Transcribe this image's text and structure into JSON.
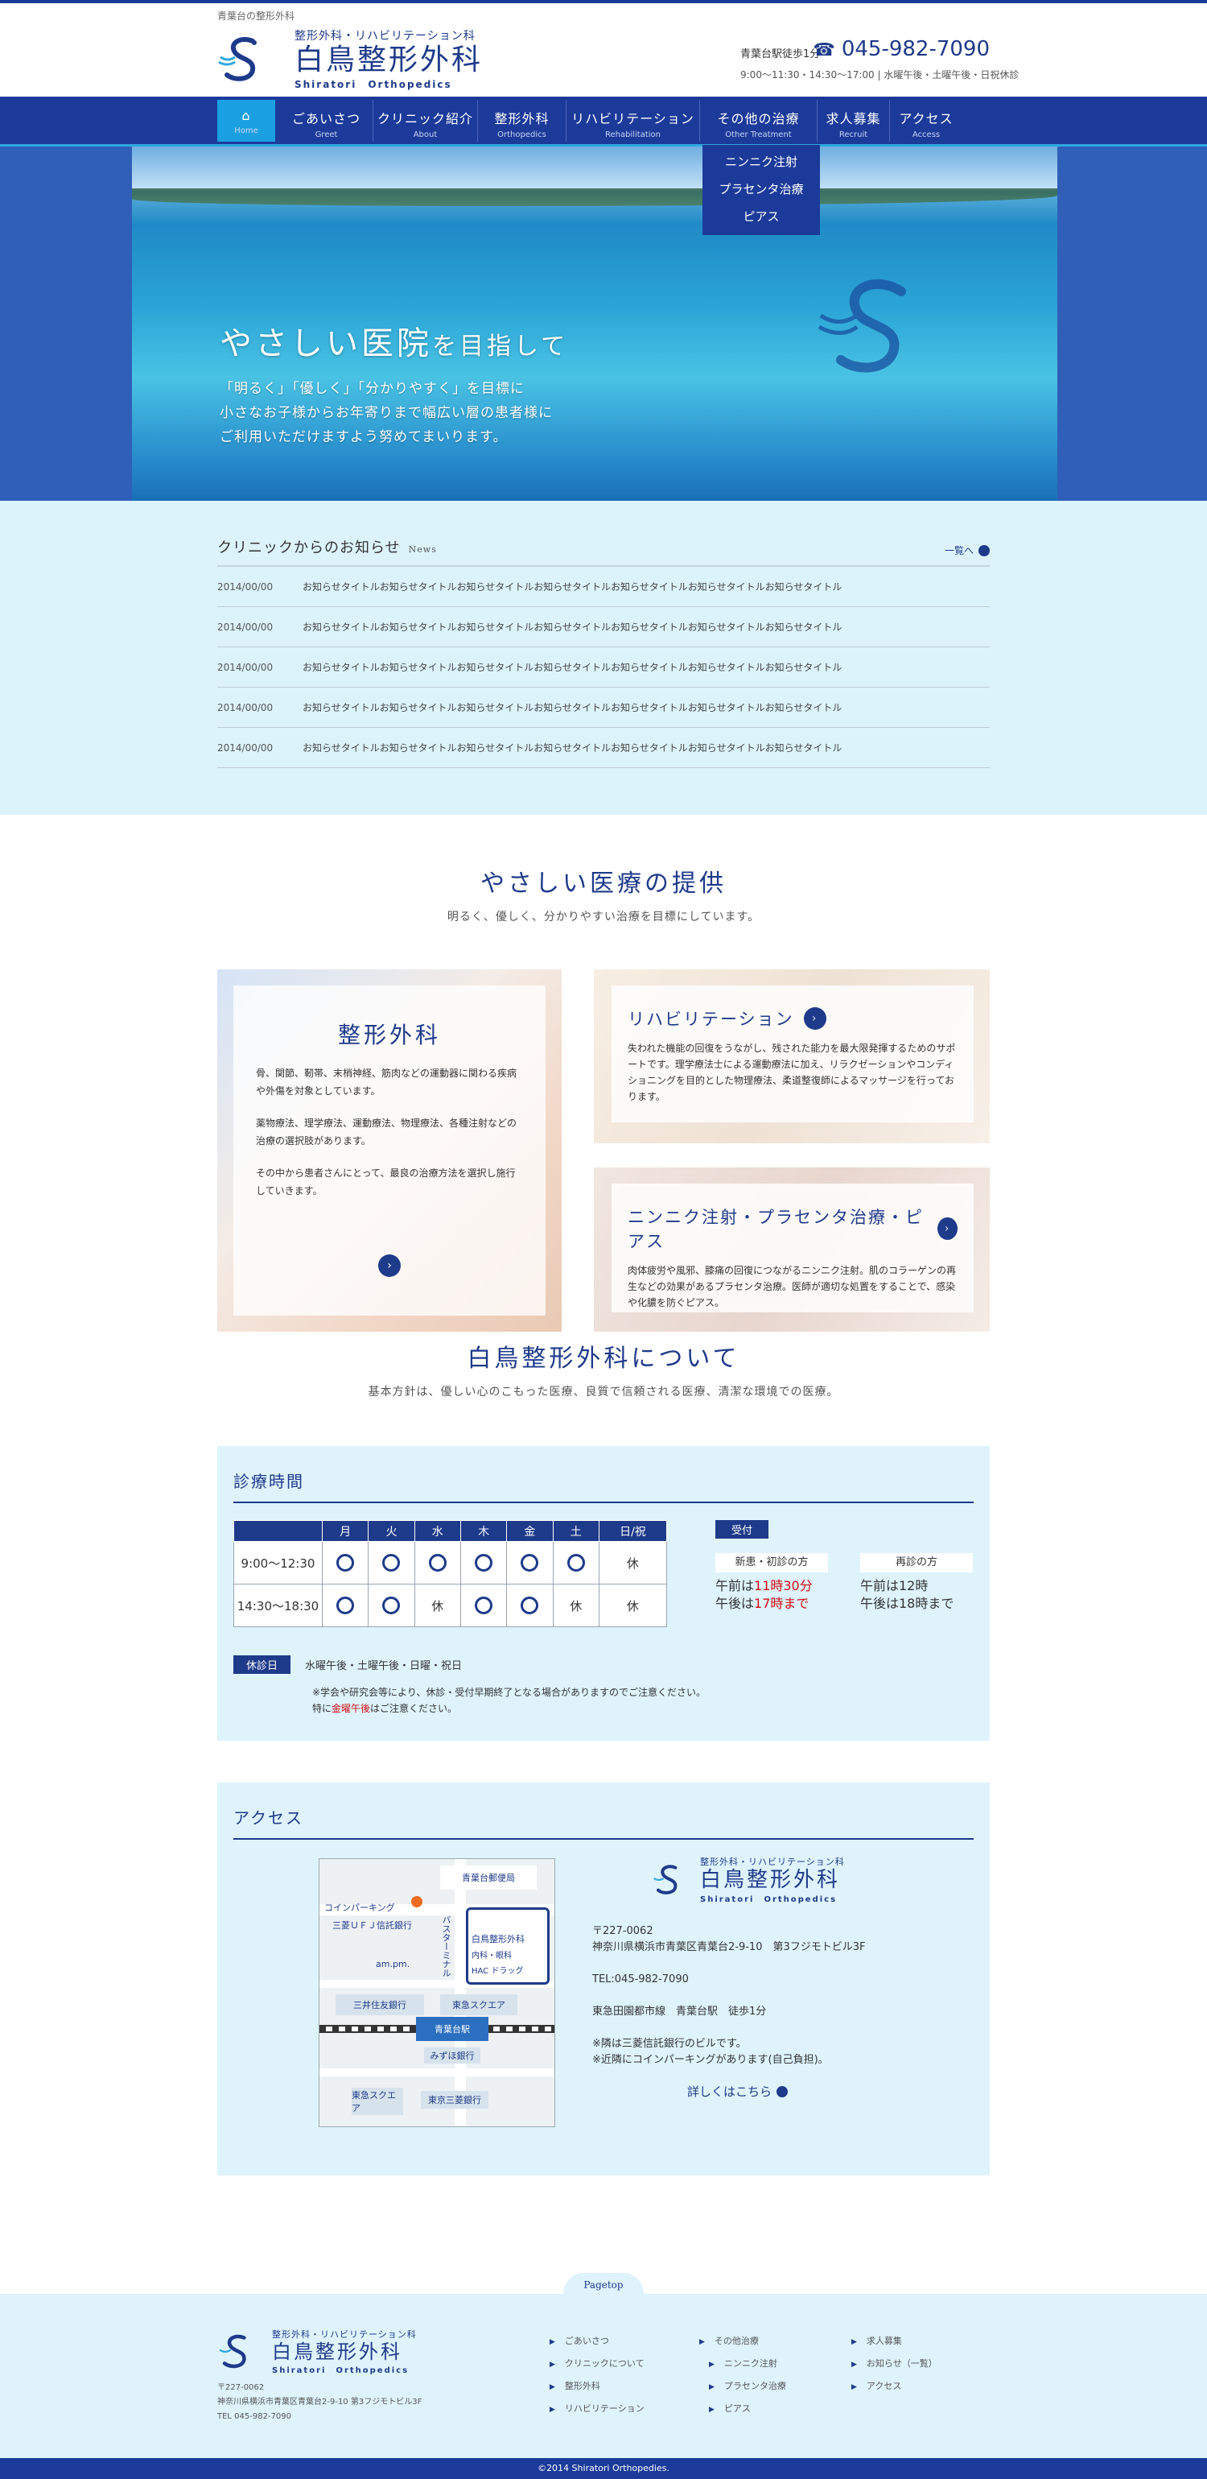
{
  "header": {
    "tagline": "青葉台の整形外科",
    "logo_sub": "整形外科・リハビリテーション科",
    "logo_main": "白鳥整形外科",
    "logo_en": "Shiratori　Orthopedics",
    "station": "青葉台駅徒歩1分",
    "phone": "045-982-7090",
    "hours": "9:00～11:30・14:30～17:00 | 水曜午後・土曜午後・日祝休診"
  },
  "nav": [
    {
      "jp": "",
      "en": "Home"
    },
    {
      "jp": "ごあいさつ",
      "en": "Greet"
    },
    {
      "jp": "クリニック紹介",
      "en": "About"
    },
    {
      "jp": "整形外科",
      "en": "Orthopedics"
    },
    {
      "jp": "リハビリテーション",
      "en": "Rehabilitation"
    },
    {
      "jp": "その他の治療",
      "en": "Other Treatment"
    },
    {
      "jp": "求人募集",
      "en": "Recruit"
    },
    {
      "jp": "アクセス",
      "en": "Access"
    }
  ],
  "dropdown": [
    "ニンニク注射",
    "プラセンタ治療",
    "ピアス"
  ],
  "hero": {
    "title_a": "やさしい医院",
    "title_b": "を目指して",
    "line1": "「明るく」「優しく」「分かりやすく」を目標に",
    "line2": "小さなお子様からお年寄りまで幅広い層の患者様に",
    "line3": "ご利用いただけますよう努めてまいります。"
  },
  "news": {
    "title": "クリニックからのお知らせ",
    "title_en": "News",
    "more": "一覧へ",
    "items": [
      {
        "date": "2014/00/00",
        "text": "お知らせタイトルお知らせタイトルお知らせタイトルお知らせタイトルお知らせタイトルお知らせタイトルお知らせタイトル"
      },
      {
        "date": "2014/00/00",
        "text": "お知らせタイトルお知らせタイトルお知らせタイトルお知らせタイトルお知らせタイトルお知らせタイトルお知らせタイトル"
      },
      {
        "date": "2014/00/00",
        "text": "お知らせタイトルお知らせタイトルお知らせタイトルお知らせタイトルお知らせタイトルお知らせタイトルお知らせタイトル"
      },
      {
        "date": "2014/00/00",
        "text": "お知らせタイトルお知らせタイトルお知らせタイトルお知らせタイトルお知らせタイトルお知らせタイトルお知らせタイトル"
      },
      {
        "date": "2014/00/00",
        "text": "お知らせタイトルお知らせタイトルお知らせタイトルお知らせタイトルお知らせタイトルお知らせタイトルお知らせタイトル"
      }
    ]
  },
  "offer": {
    "title": "やさしい医療の提供",
    "sub": "明るく、優しく、分かりやすい治療を目標にしています。",
    "ortho": {
      "title": "整形外科",
      "p1": "骨、関節、靭帯、末梢神経、筋肉などの運動器に関わる疾病や外傷を対象としています。",
      "p2": "薬物療法、理学療法、運動療法、物理療法、各種注射などの治療の選択肢があります。",
      "p3": "その中から患者さんにとって、最良の治療方法を選択し施行していきます。"
    },
    "rehab": {
      "title": "リハビリテーション",
      "text": "失われた機能の回復をうながし、残された能力を最大限発揮するためのサポートです。理学療法士による運動療法に加え、リラクゼーションやコンディショニングを目的とした物理療法、柔道整復師によるマッサージを行っております。"
    },
    "other": {
      "title": "ニンニク注射・プラセンタ治療・ピアス",
      "text": "肉体疲労や風邪、膝痛の回復につながるニンニク注射。肌のコラーゲンの再生などの効果があるプラセンタ治療。医師が適切な処置をすることで、感染や化膿を防ぐピアス。"
    }
  },
  "about": {
    "title": "白鳥整形外科について",
    "sub": "基本方針は、優しい心のこもった医療、良質で信頼される医療、清潔な環境での医療。"
  },
  "schedule": {
    "title": "診療時間",
    "days": [
      "月",
      "火",
      "水",
      "木",
      "金",
      "土",
      "日/祝"
    ],
    "rows": [
      {
        "label": "9:00～12:30",
        "cells": [
          "o",
          "o",
          "o",
          "o",
          "o",
          "o",
          "休"
        ]
      },
      {
        "label": "14:30～18:30",
        "cells": [
          "o",
          "o",
          "休",
          "o",
          "o",
          "休",
          "休"
        ]
      }
    ],
    "closed_mark": "休",
    "reception_badge": "受付",
    "new_title": "新患・初診の方",
    "new_am_a": "午前は",
    "new_am_b": "11時30分",
    "new_pm_a": "午後は",
    "new_pm_b": "17時まで",
    "rev_title": "再診の方",
    "rev_am": "午前は12時",
    "rev_pm": "午後は18時まで",
    "closed_badge": "休診日",
    "closed_days": "水曜午後・土曜午後・日曜・祝日",
    "note1": "※学会や研究会等により、休診・受付早期終了となる場合がありますのでご注意ください。",
    "note2a": "特に",
    "note2b": "金曜午後",
    "note2c": "はご注意ください。"
  },
  "access": {
    "title": "アクセス",
    "map": {
      "coinpark": "コインパーキング",
      "bank1": "三菱ＵＦＪ信託銀行",
      "post": "青葉台郵便局",
      "bus": "バスターミナル",
      "ampm": "am.pm.",
      "clinic": "白鳥整形外科",
      "clinic_sub": "内科・眼科",
      "drug": "HAC ドラッグ",
      "sumitomo": "三井住友銀行",
      "tokyu": "東急スクエア",
      "station": "青葉台駅",
      "mizuho": "みずほ銀行",
      "tokyu2": "東急スクエア",
      "mitsubishi": "東京三菱銀行"
    },
    "zip": "〒227-0062",
    "address": "神奈川県横浜市青葉区青葉台2-9-10　第3フジモトビル3F",
    "tel": "TEL:045-982-7090",
    "line": "東急田園都市線　青葉台駅　徒歩1分",
    "note1": "※隣は三菱信託銀行のビルです。",
    "note2": "※近隣にコインパーキングがあります(自己負担)。",
    "more": "詳しくはこちら"
  },
  "footer": {
    "pagetop": "Pagetop",
    "zip": "〒227-0062",
    "address": "神奈川県横浜市青葉区青葉台2-9-10 第3フジモトビル3F",
    "tel": "TEL 045-982-7090",
    "col1": [
      "ごあいさつ",
      "クリニックについて",
      "整形外科",
      "リハビリテーション"
    ],
    "col2": [
      "その他治療",
      "ニンニク注射",
      "プラセンタ治療",
      "ピアス"
    ],
    "col3": [
      "求人募集",
      "お知らせ（一覧）",
      "アクセス"
    ],
    "copyright": "©2014 Shiratori Orthopedies."
  },
  "colors": {
    "primary": "#1c3a9a",
    "accent": "#2ea7e0",
    "light": "#def3fc",
    "red": "#d01010"
  }
}
